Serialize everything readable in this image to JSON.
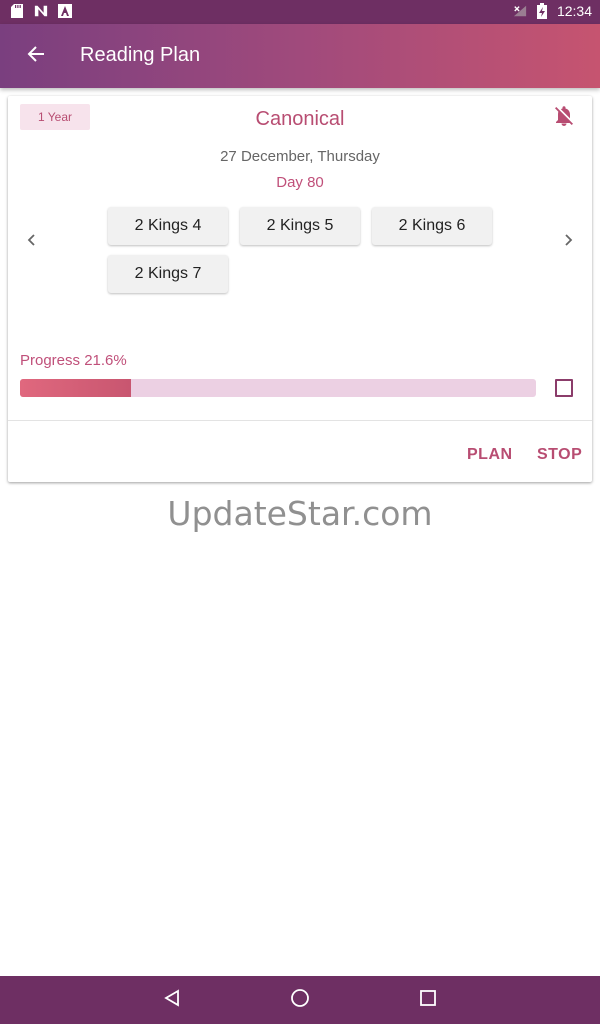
{
  "status_bar": {
    "time": "12:34",
    "left_icons": [
      "sd-card-icon",
      "n-app-icon",
      "a-app-icon"
    ],
    "right_icons": [
      "no-signal-icon",
      "battery-charging-icon"
    ]
  },
  "app_bar": {
    "title": "Reading Plan",
    "back_icon": "arrow-left-icon",
    "background_from": "#7a3f7f",
    "background_to": "#c65470"
  },
  "plan_card": {
    "badge": "1 Year",
    "title": "Canonical",
    "notification_icon": "bell-off-icon",
    "date": "27 December, Thursday",
    "day": "Day 80",
    "readings": [
      "2 Kings 4",
      "2 Kings 5",
      "2 Kings 6",
      "2 Kings 7"
    ],
    "progress_label": "Progress 21.6%",
    "progress_fraction": 0.216,
    "completed": false,
    "actions": {
      "plan": "PLAN",
      "stop": "STOP"
    },
    "accent_color": "#b84d72"
  },
  "watermark": "UpdateStar.com",
  "nav_bar": {
    "icons": [
      "triangle-back-icon",
      "circle-home-icon",
      "square-recents-icon"
    ]
  }
}
